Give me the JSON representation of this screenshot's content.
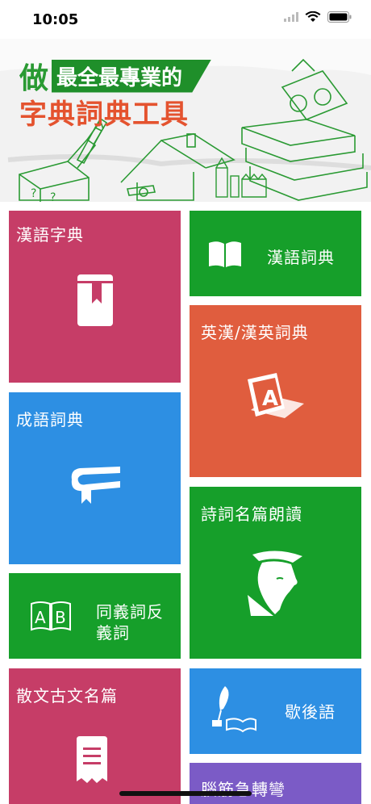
{
  "status": {
    "time": "10:05"
  },
  "banner": {
    "prefix": "做",
    "line1": "最全最專業的",
    "line2": "字典詞典工具"
  },
  "tiles": [
    {
      "id": "hanzi",
      "label": "漢語字典",
      "color": "#c63d67"
    },
    {
      "id": "hanyu-ci",
      "label": "漢語詞典",
      "color": "#169f2a"
    },
    {
      "id": "ying-han",
      "label": "英漢/漢英詞典",
      "color": "#e05d3e"
    },
    {
      "id": "chengyu",
      "label": "成語詞典",
      "color": "#2d8fe3"
    },
    {
      "id": "shici",
      "label": "詩詞名篇朗讀",
      "color": "#169f2a"
    },
    {
      "id": "tongyi-line1",
      "label": "同義詞反",
      "color": "#169f2a"
    },
    {
      "id": "tongyi-line2",
      "label": "義詞",
      "color": "#169f2a"
    },
    {
      "id": "sanwen",
      "label": "散文古文名篇",
      "color": "#c63d67"
    },
    {
      "id": "xiehouyu",
      "label": "歇後語",
      "color": "#2d8fe3"
    },
    {
      "id": "naojin",
      "label": "腦筋急轉彎",
      "color": "#7b5bc6"
    }
  ],
  "icons": [
    "wifi-icon",
    "battery-icon",
    "signal-icon",
    "bookmark-book-icon",
    "open-book-icon",
    "a-book-icon",
    "closed-book-icon",
    "poet-icon",
    "ab-book-icon",
    "receipt-icon",
    "quill-book-icon"
  ]
}
